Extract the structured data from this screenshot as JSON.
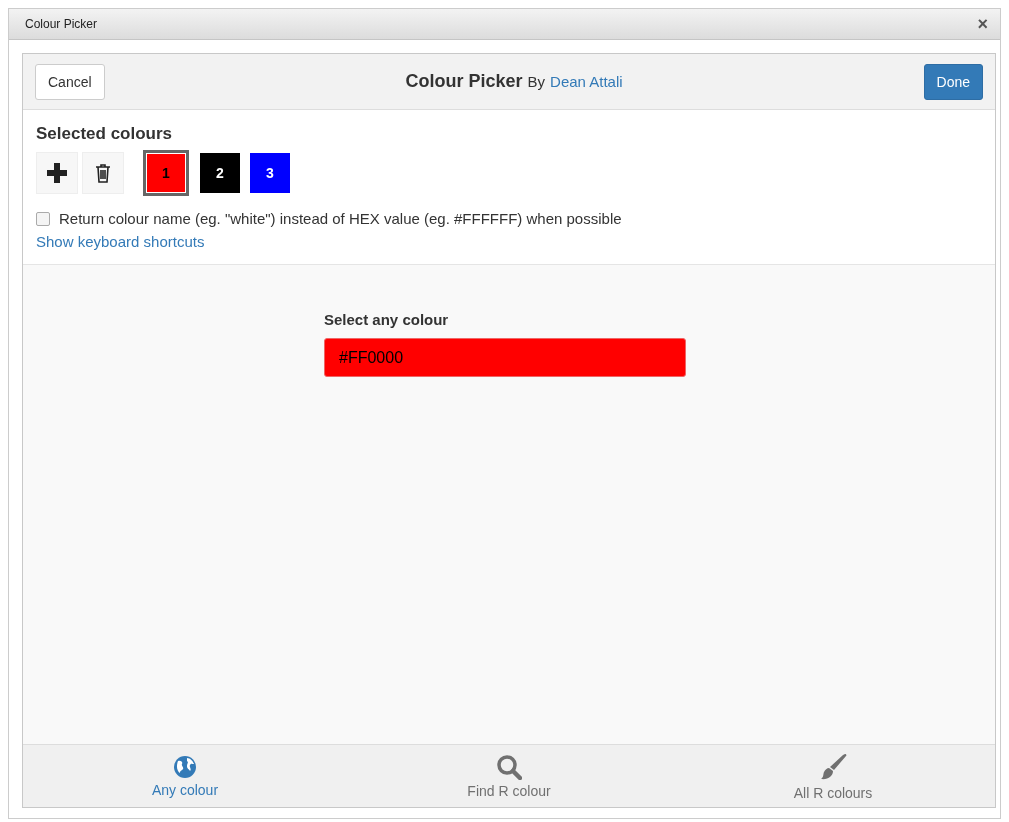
{
  "window": {
    "title": "Colour Picker",
    "close": "×"
  },
  "header": {
    "cancel": "Cancel",
    "title": "Colour Picker",
    "by": "By",
    "author": "Dean Attali",
    "done": "Done"
  },
  "selected_colours": {
    "heading": "Selected colours",
    "swatches": [
      {
        "label": "1",
        "color": "#ff0000",
        "selected": true
      },
      {
        "label": "2",
        "color": "#000000",
        "selected": false
      },
      {
        "label": "3",
        "color": "#0000ff",
        "selected": false
      }
    ]
  },
  "return_name": {
    "label": "Return colour name (eg. \"white\") instead of HEX value (eg. #FFFFFF) when possible",
    "checked": false
  },
  "shortcuts_link": "Show keyboard shortcuts",
  "picker": {
    "label": "Select any colour",
    "value": "#FF0000",
    "color": "#ff0000"
  },
  "tabs": [
    {
      "kind": "globe",
      "label": "Any colour",
      "selected": true
    },
    {
      "kind": "search",
      "label": "Find R colour",
      "selected": false
    },
    {
      "kind": "brush",
      "label": "All R colours",
      "selected": false
    }
  ]
}
